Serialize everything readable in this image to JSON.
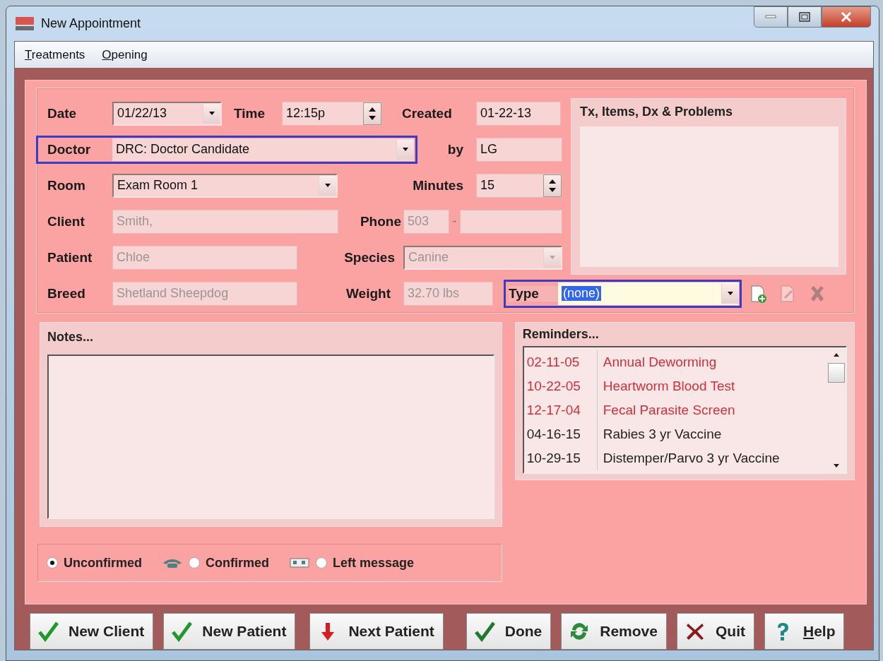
{
  "window": {
    "title": "New Appointment"
  },
  "menu": [
    {
      "label": "Treatments",
      "mnemonic": true
    },
    {
      "label": "Opening",
      "mnemonic": true
    }
  ],
  "form": {
    "rows": [
      [
        {
          "kind": "dropdown",
          "label": "Date",
          "value": "01/22/13",
          "disabled": false,
          "focused": false,
          "text_selected": false
        },
        {
          "kind": "spin",
          "label": "Time",
          "value": "12:15p",
          "disabled": false,
          "focused": false,
          "text_selected": false
        },
        {
          "kind": "text",
          "label": "Created",
          "value": "01-22-13",
          "disabled": false,
          "focused": false,
          "text_selected": false
        }
      ],
      [
        {
          "kind": "dropdown",
          "label": "Doctor",
          "value": "DRC: Doctor Candidate",
          "disabled": false,
          "focused": true,
          "text_selected": false
        },
        {
          "kind": "text",
          "label": "by",
          "value": "LG",
          "disabled": false,
          "focused": false,
          "text_selected": false
        }
      ],
      [
        {
          "kind": "dropdown",
          "label": "Room",
          "value": "Exam Room 1",
          "disabled": false,
          "focused": false,
          "text_selected": false
        },
        {
          "kind": "spin",
          "label": "Minutes",
          "value": "15",
          "disabled": false,
          "focused": false,
          "text_selected": false
        }
      ],
      [
        {
          "kind": "text",
          "label": "Client",
          "value": "Smith,",
          "disabled": true,
          "focused": false,
          "text_selected": false
        },
        {
          "kind": "phone",
          "label": "Phone",
          "value": "503",
          "separator": "-",
          "disabled": true,
          "focused": false,
          "text_selected": false
        }
      ],
      [
        {
          "kind": "text",
          "label": "Patient",
          "value": "Chloe",
          "disabled": true,
          "focused": false,
          "text_selected": false
        },
        {
          "kind": "dropdown",
          "label": "Species",
          "value": "Canine",
          "disabled": true,
          "focused": false,
          "text_selected": false
        }
      ],
      [
        {
          "kind": "text",
          "label": "Breed",
          "value": "Shetland Sheepdog",
          "disabled": true,
          "focused": false,
          "text_selected": false
        },
        {
          "kind": "text",
          "label": "Weight",
          "value": "32.70 lbs",
          "disabled": true,
          "focused": false,
          "text_selected": false
        },
        {
          "kind": "dropdown",
          "label": "Type",
          "value": "(none)",
          "disabled": false,
          "focused": true,
          "text_selected": true
        }
      ]
    ],
    "treatments_panel": {
      "title": "Tx, Items, Dx & Problems"
    },
    "type_actions": [
      {
        "kind": "add",
        "disabled": false
      },
      {
        "kind": "edit",
        "disabled": true
      },
      {
        "kind": "delete",
        "disabled": true
      }
    ]
  },
  "notes": {
    "title": "Notes..."
  },
  "reminders": {
    "title": "Reminders...",
    "items": [
      {
        "date": "02-11-05",
        "name": "Annual Deworming",
        "overdue": true
      },
      {
        "date": "10-22-05",
        "name": "Heartworm Blood Test",
        "overdue": true
      },
      {
        "date": "12-17-04",
        "name": "Fecal Parasite Screen",
        "overdue": true
      },
      {
        "date": "04-16-15",
        "name": "Rabies 3 yr Vaccine",
        "overdue": false
      },
      {
        "date": "10-29-15",
        "name": "Distemper/Parvo 3 yr Vaccine",
        "overdue": false
      }
    ]
  },
  "confirmation": [
    {
      "label": "Unconfirmed",
      "selected": true
    },
    {
      "label": "Confirmed",
      "selected": false
    },
    {
      "label": "Left message",
      "selected": false
    }
  ],
  "buttons": [
    {
      "label": "New Client",
      "mnemonic": false
    },
    {
      "label": "New Patient",
      "mnemonic": false
    },
    {
      "label": "Next Patient",
      "mnemonic": false
    },
    {
      "label": "Done",
      "mnemonic": false
    },
    {
      "label": "Remove",
      "mnemonic": false
    },
    {
      "label": "Quit",
      "mnemonic": false
    },
    {
      "label": "Help",
      "mnemonic": true
    }
  ]
}
